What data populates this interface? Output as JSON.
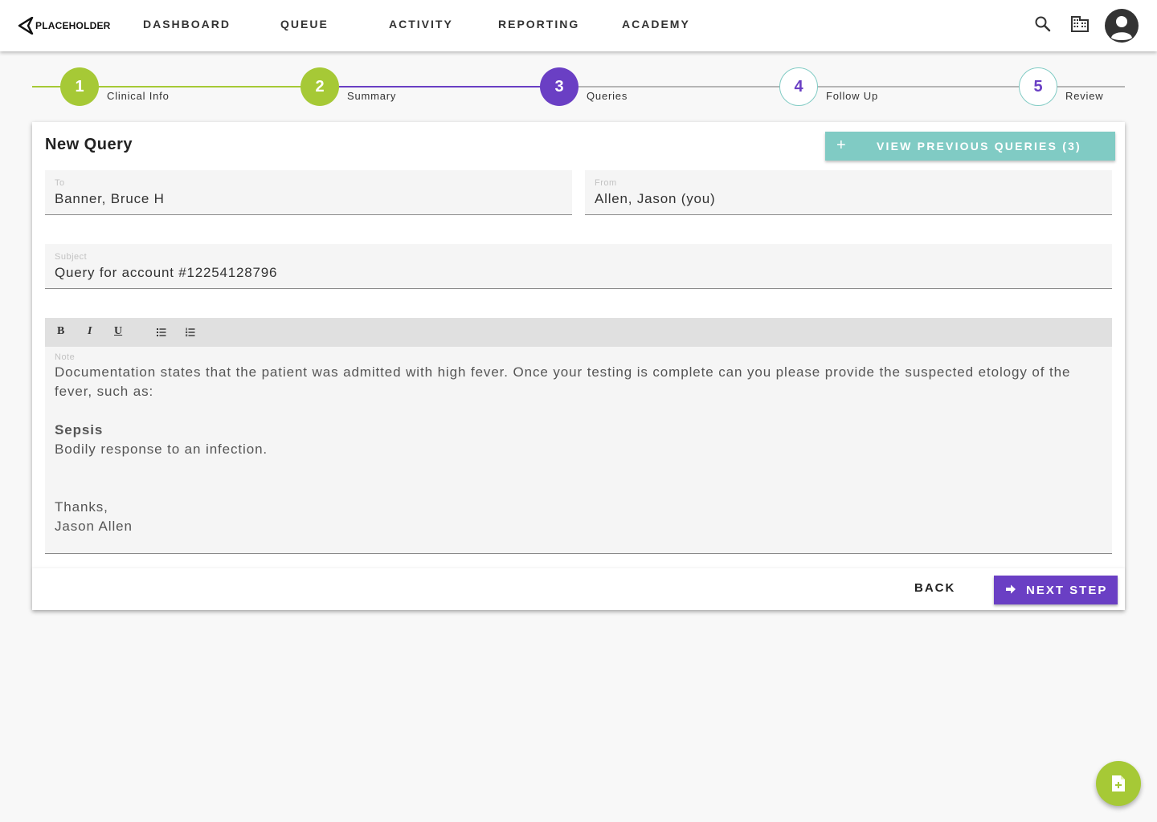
{
  "brand": {
    "logo_text": "PLACEHOLDER"
  },
  "nav": {
    "items": [
      {
        "label": "DASHBOARD"
      },
      {
        "label": "QUEUE"
      },
      {
        "label": "ACTIVITY"
      },
      {
        "label": "REPORTING"
      },
      {
        "label": "ACADEMY"
      }
    ],
    "icons": [
      "search-icon",
      "building-icon",
      "account-icon"
    ]
  },
  "stepper": {
    "steps": [
      {
        "number": "1",
        "label": "Clinical Info",
        "state": "complete"
      },
      {
        "number": "2",
        "label": "Summary",
        "state": "complete"
      },
      {
        "number": "3",
        "label": "Queries",
        "state": "active"
      },
      {
        "number": "4",
        "label": "Follow Up",
        "state": "pending"
      },
      {
        "number": "5",
        "label": "Review",
        "state": "pending"
      }
    ],
    "colors": {
      "complete": "#a6c936",
      "active": "#6a3fc4",
      "pending": "#80cbc4"
    }
  },
  "query": {
    "title": "New Query",
    "view_previous_label": "VIEW PREVIOUS QUERIES (3)",
    "to": {
      "label": "To",
      "value": "Banner, Bruce H"
    },
    "from": {
      "label": "From",
      "value": "Allen, Jason (you)"
    },
    "subject": {
      "label": "Subject",
      "value": "Query for account #12254128796"
    },
    "toolbar": {
      "bold": "B",
      "italic": "I",
      "underline": "U"
    },
    "note": {
      "label": "Note",
      "intro": "Documentation states that the patient was admitted with high fever. Once your testing is complete can you please provide the suspected etology of the fever, such as:",
      "term": "Sepsis",
      "definition": "Bodily response to an infection.",
      "signoff": "Thanks,",
      "signature": "Jason Allen"
    },
    "back_label": "BACK",
    "next_label": "NEXT STEP"
  },
  "colors": {
    "accent_purple": "#6a3fc4",
    "accent_green": "#a6c936",
    "accent_teal": "#80cbc4"
  }
}
